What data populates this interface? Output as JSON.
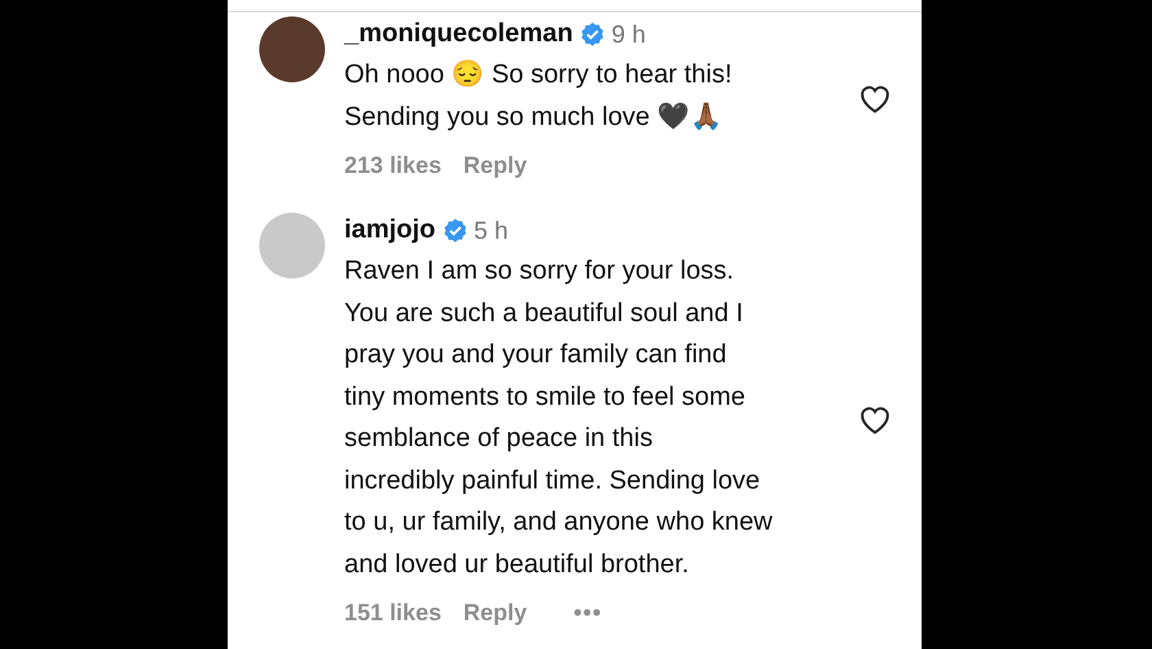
{
  "comments": [
    {
      "username": "_moniquecoleman",
      "verified": true,
      "time": "9 h",
      "text": "Oh nooo 😔 So sorry to hear this!\nSending you so much love 🖤🙏🏾",
      "likes": "213 likes",
      "reply": "Reply",
      "liked": false
    },
    {
      "username": "iamjojo",
      "verified": true,
      "time": "5 h",
      "text": "Raven I am so sorry for your loss.\nYou are such a beautiful soul and I\npray you and your family can find\ntiny moments to smile to feel some\nsemblance of peace in this\nincredibly painful time. Sending love\nto u, ur family, and anyone who knew\nand loved ur beautiful brother.",
      "likes": "151 likes",
      "reply": "Reply",
      "more": "•••",
      "liked": false
    }
  ]
}
